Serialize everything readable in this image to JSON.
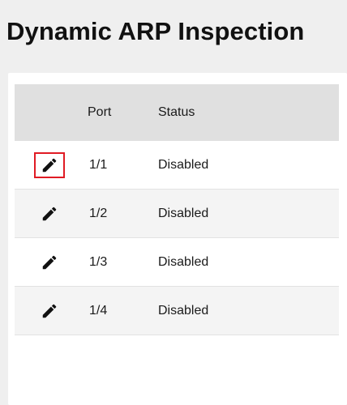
{
  "page": {
    "title": "Dynamic ARP Inspection"
  },
  "table": {
    "columns": {
      "edit": "",
      "port": "Port",
      "status": "Status"
    },
    "rows": [
      {
        "port": "1/1",
        "status": "Disabled",
        "edit_icon": "pencil-icon",
        "focused": true
      },
      {
        "port": "1/2",
        "status": "Disabled",
        "edit_icon": "pencil-icon",
        "focused": false
      },
      {
        "port": "1/3",
        "status": "Disabled",
        "edit_icon": "pencil-icon",
        "focused": false
      },
      {
        "port": "1/4",
        "status": "Disabled",
        "edit_icon": "pencil-icon",
        "focused": false
      }
    ]
  },
  "colors": {
    "focus_outline": "#e01b24",
    "header_bg": "#e0e0e0",
    "alt_row_bg": "#f4f4f4"
  }
}
